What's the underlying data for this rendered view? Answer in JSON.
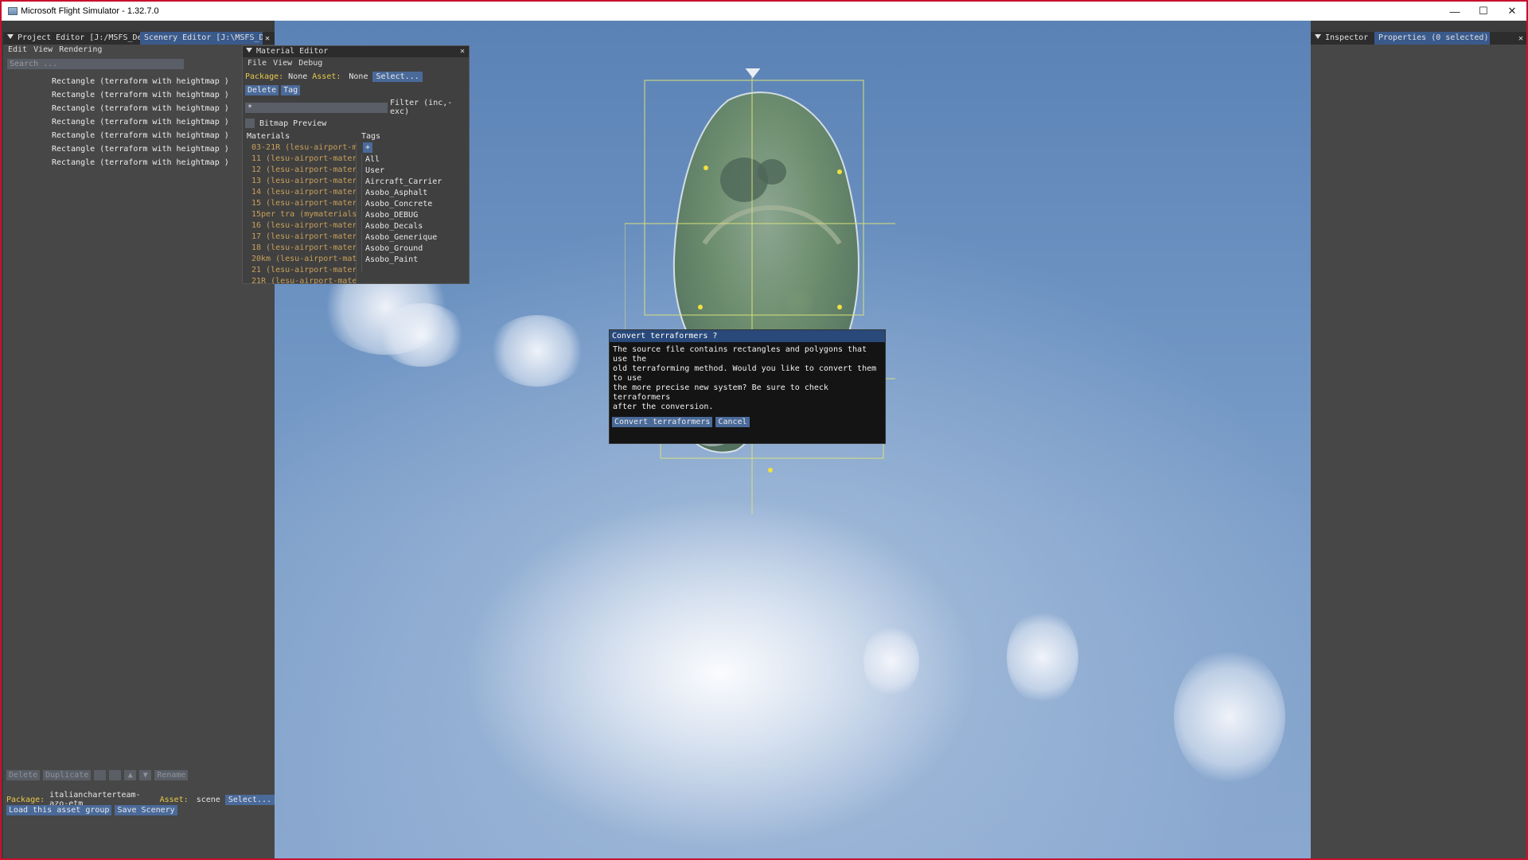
{
  "window": {
    "title": "Microsoft Flight Simulator - 1.32.7.0",
    "controls": [
      "—",
      "☐",
      "✕"
    ]
  },
  "left_panel": {
    "tabs": [
      "Project Editor [J:/MSFS_De…",
      "Scenery Editor [J:\\MSFS_De…"
    ],
    "tab_close": "✕",
    "menu": [
      "Edit",
      "View",
      "Rendering"
    ],
    "search_placeholder": "Search ...",
    "items": [
      "Rectangle (terraform with heightmap )",
      "Rectangle (terraform with heightmap )",
      "Rectangle (terraform with heightmap )",
      "Rectangle (terraform with heightmap )",
      "Rectangle (terraform with heightmap )",
      "Rectangle (terraform with heightmap )",
      "Rectangle (terraform with heightmap )"
    ],
    "toolbar": {
      "delete": "Delete",
      "duplicate": "Duplicate",
      "rename": "Rename"
    },
    "package_label": "Package:",
    "package_value": "italiancharterteam-azo-etm",
    "asset_label": "Asset:",
    "asset_value": "scene",
    "select_button": "Select...",
    "load_group_button": "Load this asset group",
    "save_scenery_button": "Save Scenery"
  },
  "material_editor": {
    "title": "Material Editor",
    "menu": [
      "File",
      "View",
      "Debug"
    ],
    "package_label": "Package:",
    "package_value": "None",
    "asset_label": "Asset:",
    "asset_value": "None",
    "select_button": "Select...",
    "delete_button": "Delete",
    "tag_button": "Tag",
    "filter_value": "*",
    "filter_label": "Filter (inc,-exc)",
    "bitmap_preview_label": "Bitmap Preview",
    "materials_header": "Materials",
    "tags_header": "Tags",
    "tags_add": "+",
    "materials": [
      "03-21R (lesu-airport-m",
      "11 (lesu-airport-mater",
      "12 (lesu-airport-mater",
      "13 (lesu-airport-mater",
      "14 (lesu-airport-mater",
      "15 (lesu-airport-mater",
      "15per tra (mymaterials",
      "16 (lesu-airport-mater",
      "17 (lesu-airport-mater",
      "18 (lesu-airport-mater",
      "20km (lesu-airport-mat",
      "21 (lesu-airport-mater",
      "21R (lesu-airport-mate"
    ],
    "tags": [
      "All",
      "User",
      "Aircraft_Carrier",
      "Asobo_Asphalt",
      "Asobo_Concrete",
      "Asobo_DEBUG",
      "Asobo_Decals",
      "Asobo_Generique",
      "Asobo_Ground",
      "Asobo_Paint"
    ]
  },
  "dialog": {
    "title": "Convert terraformers ?",
    "body": "The source file contains rectangles and polygons that use the\nold terraforming method. Would you like to convert them to use\nthe more precise new system? Be sure to check terraformers\nafter the conversion.",
    "confirm_button": "Convert terraformers",
    "cancel_button": "Cancel"
  },
  "inspector": {
    "tab_inspector": "Inspector",
    "tab_properties": "Properties (0 selected)",
    "close": "✕"
  },
  "colors": {
    "frame_red": "#c8102e",
    "panel": "#474747",
    "accent_blue": "#3a5a8c",
    "label_yellow": "#e8c84a",
    "material_orange": "#c9a05a"
  }
}
